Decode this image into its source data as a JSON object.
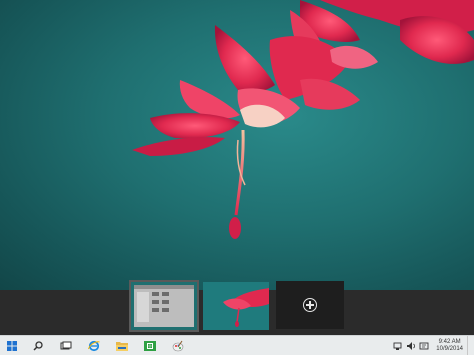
{
  "desktop": {
    "wallpaper": "pink-flower-on-teal",
    "colors": {
      "background": "#1f6f70",
      "flower": "#e0294f"
    }
  },
  "task_view": {
    "desktops": [
      {
        "name": "desktop-1",
        "selected": true,
        "content": "file-explorer-window"
      },
      {
        "name": "desktop-2",
        "selected": false,
        "content": "wallpaper"
      }
    ],
    "add_desktop_icon": "plus-icon"
  },
  "taskbar": {
    "items": [
      {
        "name": "start",
        "icon": "windows-logo-icon"
      },
      {
        "name": "search",
        "icon": "search-icon"
      },
      {
        "name": "task-view",
        "icon": "task-view-icon"
      },
      {
        "name": "internet-explorer",
        "icon": "internet-explorer-icon"
      },
      {
        "name": "file-explorer",
        "icon": "folder-icon"
      },
      {
        "name": "store",
        "icon": "store-icon"
      },
      {
        "name": "paint",
        "icon": "paint-icon"
      }
    ],
    "tray": {
      "icons": [
        "network-icon",
        "volume-icon",
        "action-center-icon"
      ],
      "time": "9:42 AM",
      "date": "10/9/2014"
    }
  }
}
